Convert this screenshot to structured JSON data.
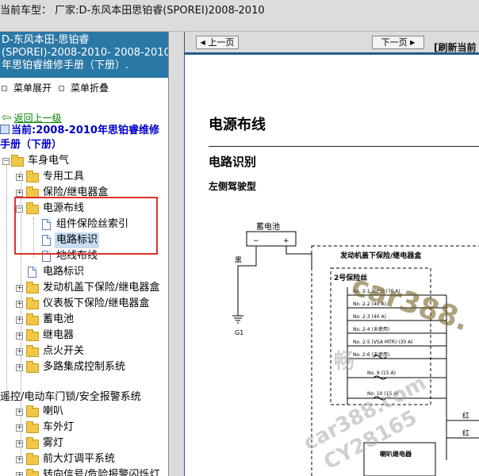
{
  "window": {
    "title": "当前车型：  厂家:D-东风本田思铂睿(SPOREI)2008-2010"
  },
  "left": {
    "header_lines": [
      "D-东风本田-思铂睿",
      "(SPOREI)-2008-2010- 2008-2010",
      "年思铂睿维修手册（下册）."
    ],
    "expand_all": "菜单展开",
    "collapse_all": "菜单折叠",
    "back_link": "返回上一级",
    "current_label": "当前:2008-2010年思铂睿维修手册（下册）",
    "tree": [
      {
        "label": "车身电气",
        "level": 0,
        "kind": "folder-open"
      },
      {
        "label": "专用工具",
        "level": 1,
        "kind": "folder"
      },
      {
        "label": "保险/继电器盒",
        "level": 1,
        "kind": "folder"
      },
      {
        "label": "电源布线",
        "level": 1,
        "kind": "folder-open"
      },
      {
        "label": "组件保险丝索引",
        "level": 2,
        "kind": "doc"
      },
      {
        "label": "电路标识",
        "level": 2,
        "kind": "doc",
        "selected": true
      },
      {
        "label": "地线布线",
        "level": 2,
        "kind": "doc"
      },
      {
        "label": "电路标识",
        "level": 1,
        "kind": "doc"
      },
      {
        "label": "发动机盖下保险/继电器盒",
        "level": 1,
        "kind": "folder"
      },
      {
        "label": "仪表板下保险/继电器盒",
        "level": 1,
        "kind": "folder"
      },
      {
        "label": "蓄电池",
        "level": 1,
        "kind": "folder"
      },
      {
        "label": "继电器",
        "level": 1,
        "kind": "folder"
      },
      {
        "label": "点火开关",
        "level": 1,
        "kind": "folder"
      },
      {
        "label": "多路集成控制系统",
        "level": 1,
        "kind": "folder"
      },
      {
        "label": "遥控/电动车门锁/安全报警系统",
        "level": 0,
        "kind": "text"
      },
      {
        "label": "喇叭",
        "level": 1,
        "kind": "folder"
      },
      {
        "label": "车外灯",
        "level": 1,
        "kind": "folder"
      },
      {
        "label": "雾灯",
        "level": 1,
        "kind": "folder"
      },
      {
        "label": "前大灯调平系统",
        "level": 1,
        "kind": "folder"
      },
      {
        "label": "转向信号/危险报警闪烁灯",
        "level": 1,
        "kind": "folder"
      }
    ]
  },
  "right": {
    "prev_button": "上一页",
    "next_button": "下一页",
    "refresh": "[刷新当前",
    "doc_title": "电源布线",
    "section_title": "电路识别",
    "sub_title": "左侧驾驶型"
  },
  "diagram": {
    "battery": "蓄电池",
    "plus": "+",
    "minus": "−",
    "black": "黑",
    "ground": "G1",
    "box_title": "发动机盖下保险/继电器盒",
    "fuse_group": "2号保险丝",
    "fuses": [
      "No. 2-1 (EPS) (70 A)",
      "No. 2-2 (40 A)",
      "No. 2-3 (40 A)",
      "No. 2-4 (未使用)",
      "No. 2-5 (VSA MTR) (30 A)",
      "No. 2-6 (未使用)",
      "No. 9 (15 A)",
      "No. 10 (15 A)"
    ],
    "red": "红",
    "horn_relay": "喇叭继电器"
  },
  "watermarks": [
    "car388.",
    "畅",
    "car388.com",
    "CY28165"
  ],
  "colors": {
    "header_blue": "#2a78a6",
    "highlight_red": "#e0312b",
    "link_green": "#008000",
    "current_blue": "#0000c8"
  }
}
